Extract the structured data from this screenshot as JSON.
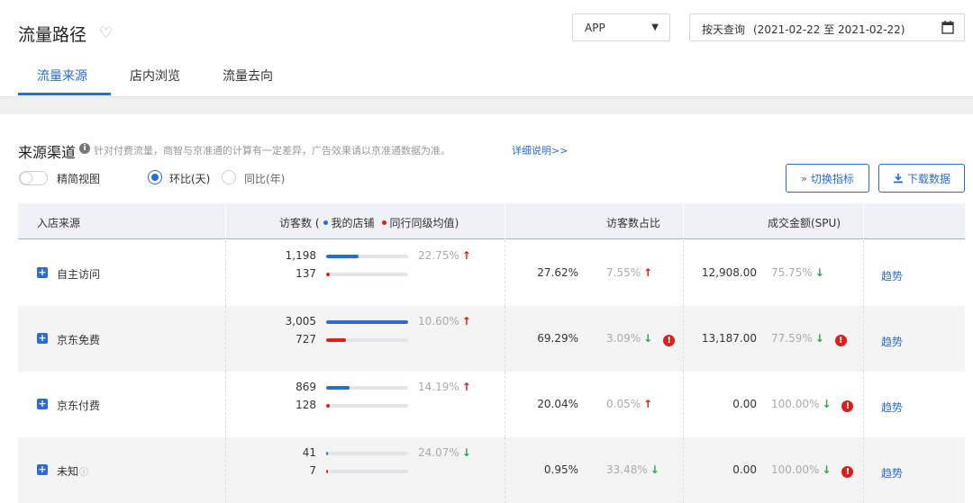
{
  "page": {
    "title": "流量路径"
  },
  "filters": {
    "platform": "APP",
    "date_mode": "按天查询",
    "date_range": "(2021-02-22 至 2021-02-22)"
  },
  "tabs": [
    {
      "label": "流量来源",
      "active": true
    },
    {
      "label": "店内浏览",
      "active": false
    },
    {
      "label": "流量去向",
      "active": false
    }
  ],
  "section": {
    "title": "来源渠道",
    "note": "针对付费流量，商智与京准通的计算有一定差异，广告效果请以京准通数据为准。",
    "detail_link": "详细说明>>",
    "toggle_label": "精简视图",
    "toggle_on": false,
    "radios": [
      {
        "label": "环比(天)",
        "checked": true
      },
      {
        "label": "同比(年)",
        "checked": false
      }
    ],
    "buttons": {
      "switch_metrics": "切换指标",
      "download": "下载数据"
    }
  },
  "table": {
    "headers": {
      "source": "入店来源",
      "visitors": "访客数",
      "legend_open": "(",
      "legend_mine": "我的店铺",
      "legend_peer": "同行同级均值",
      "legend_close": ")",
      "share": "访客数占比",
      "sales": "成交金额(SPU)"
    },
    "max_visitors": 3005,
    "rows": [
      {
        "name": "自主访问",
        "has_help": false,
        "mine": "1,198",
        "mine_value": 1198,
        "peer": "137",
        "peer_value": 137,
        "visitor_change": "22.75%",
        "visitor_dir": "up",
        "share": "27.62%",
        "share_change": "7.55%",
        "share_dir": "up",
        "share_warn": false,
        "sales": "12,908.00",
        "sales_change": "75.75%",
        "sales_dir": "down",
        "sales_warn": false,
        "trend": "趋势"
      },
      {
        "name": "京东免费",
        "has_help": false,
        "mine": "3,005",
        "mine_value": 3005,
        "peer": "727",
        "peer_value": 727,
        "visitor_change": "10.60%",
        "visitor_dir": "up",
        "share": "69.29%",
        "share_change": "3.09%",
        "share_dir": "down",
        "share_warn": true,
        "sales": "13,187.00",
        "sales_change": "77.59%",
        "sales_dir": "down",
        "sales_warn": true,
        "trend": "趋势"
      },
      {
        "name": "京东付费",
        "has_help": false,
        "mine": "869",
        "mine_value": 869,
        "peer": "128",
        "peer_value": 128,
        "visitor_change": "14.19%",
        "visitor_dir": "up",
        "share": "20.04%",
        "share_change": "0.05%",
        "share_dir": "up",
        "share_warn": false,
        "sales": "0.00",
        "sales_change": "100.00%",
        "sales_dir": "down",
        "sales_warn": true,
        "trend": "趋势"
      },
      {
        "name": "未知",
        "has_help": true,
        "mine": "41",
        "mine_value": 41,
        "peer": "7",
        "peer_value": 7,
        "visitor_change": "24.07%",
        "visitor_dir": "down",
        "share": "0.95%",
        "share_change": "33.48%",
        "share_dir": "down",
        "share_warn": false,
        "sales": "0.00",
        "sales_change": "100.00%",
        "sales_dir": "down",
        "sales_warn": true,
        "trend": "趋势"
      }
    ]
  },
  "colors": {
    "accent": "#2b6bd4",
    "mine_bar": "#2b6bd4",
    "peer_bar": "#d9201a",
    "up": "#d9201a",
    "down": "#2aa64a"
  },
  "icons": {
    "favorite": "heart-outline-icon",
    "calendar": "calendar-icon",
    "info": "info-icon",
    "expand": "plus-square-icon",
    "warning": "warning-icon",
    "switch": "chevron-double-down-icon",
    "download": "download-icon",
    "help": "question-circle-icon"
  }
}
